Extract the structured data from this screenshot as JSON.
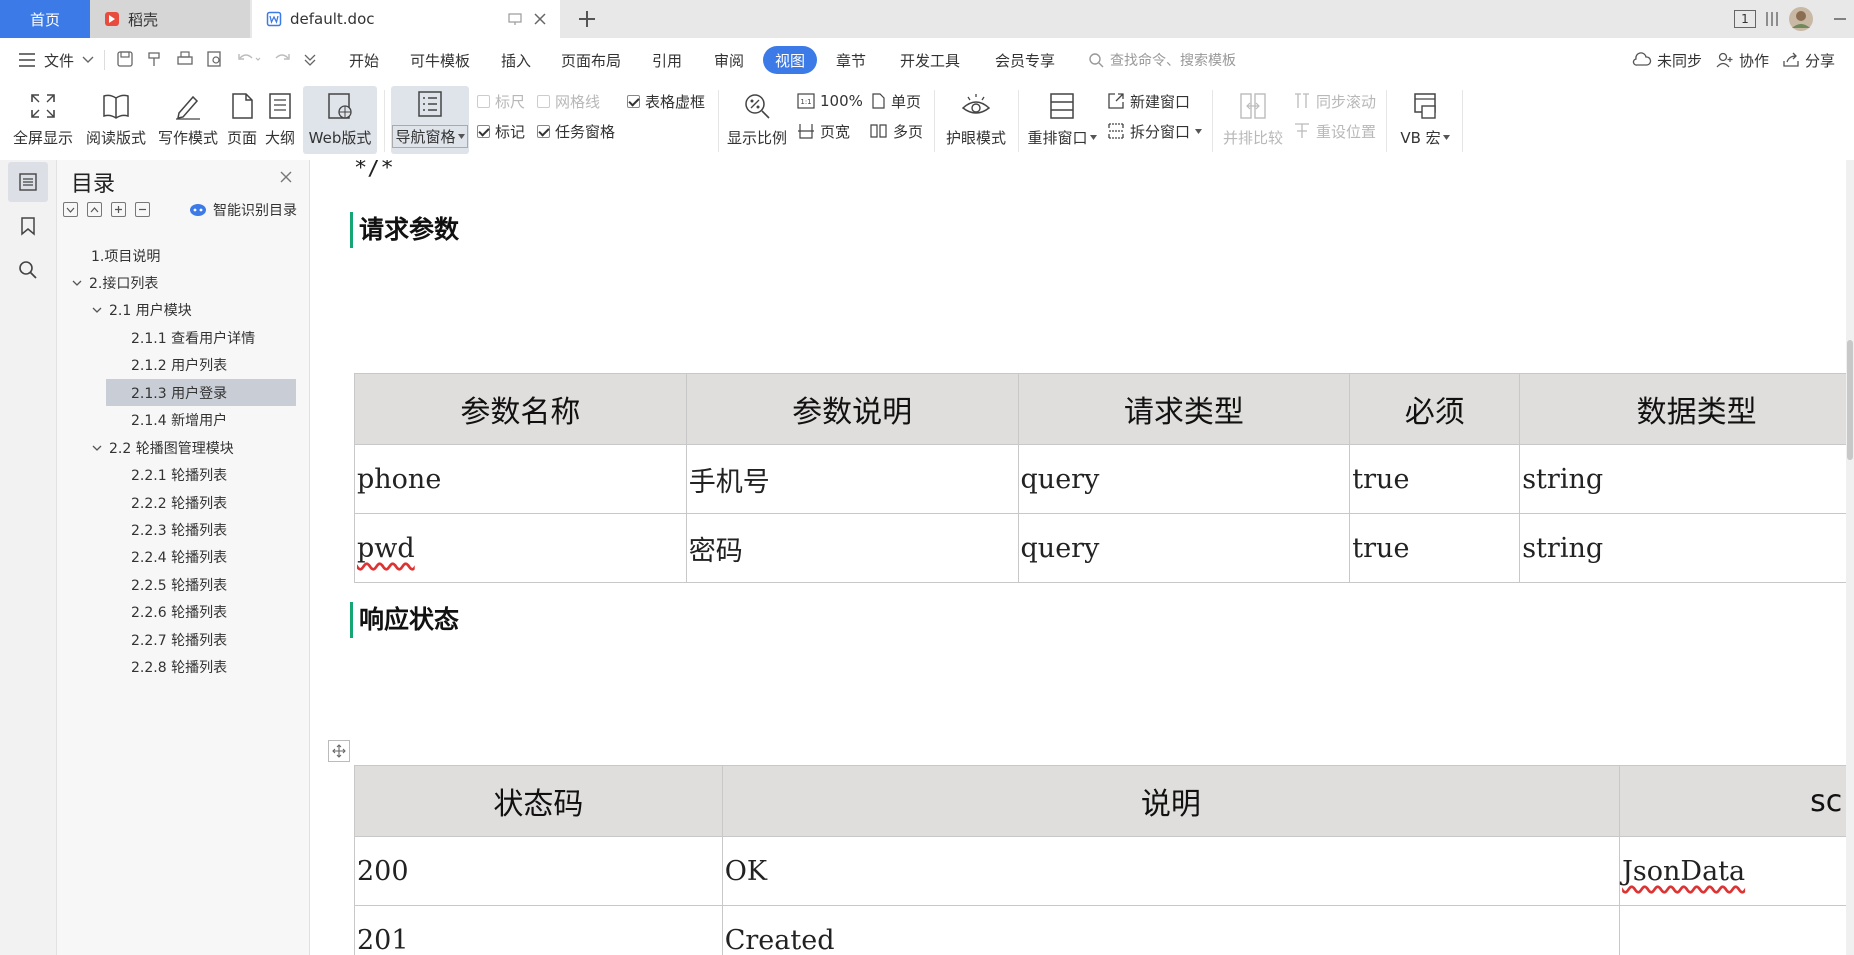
{
  "tabs": {
    "home": "首页",
    "daoke": "稻壳",
    "doc": "default.doc"
  },
  "titlebar": {
    "badge": "1"
  },
  "menu": {
    "file": "文件",
    "items": [
      "开始",
      "可牛模板",
      "插入",
      "页面布局",
      "引用",
      "审阅",
      "视图",
      "章节",
      "开发工具",
      "会员专享"
    ],
    "search_placeholder": "查找命令、搜索模板",
    "unsynced": "未同步",
    "collab": "协作",
    "share": "分享"
  },
  "ribbon": {
    "fullscreen": "全屏显示",
    "reading": "阅读版式",
    "writing": "写作模式",
    "page": "页面",
    "outline": "大纲",
    "web": "Web版式",
    "nav_pane": "导航窗格",
    "ruler": "标尺",
    "gridlines": "网格线",
    "table_gridlines": "表格虚框",
    "marks": "标记",
    "task_pane": "任务窗格",
    "zoom": "显示比例",
    "zoom100": "100%",
    "page_width": "页宽",
    "single_page": "单页",
    "multi_page": "多页",
    "eye_care": "护眼模式",
    "rearrange": "重排窗口",
    "new_window": "新建窗口",
    "split_window": "拆分窗口",
    "side_by_side": "并排比较",
    "sync_scroll": "同步滚动",
    "reset_pos": "重设位置",
    "vb_macro": "VB 宏"
  },
  "toc": {
    "title": "目录",
    "smart_toc": "智能识别目录",
    "items": [
      "1.项目说明",
      "2.接口列表",
      "2.1 用户模块",
      "2.1.1 查看用户详情",
      "2.1.2 用户列表",
      "2.1.3 用户登录",
      "2.1.4 新增用户",
      "2.2 轮播图管理模块",
      "2.2.1 轮播列表",
      "2.2.2 轮播列表",
      "2.2.3 轮播列表",
      "2.2.4 轮播列表",
      "2.2.5 轮播列表",
      "2.2.6 轮播列表",
      "2.2.7 轮播列表",
      "2.2.8 轮播列表"
    ]
  },
  "doc": {
    "code_fragment": "*/*",
    "heading_params": "请求参数",
    "params_table": {
      "headers": [
        "参数名称",
        "参数说明",
        "请求类型",
        "必须",
        "数据类型"
      ],
      "rows": [
        [
          "phone",
          "手机号",
          "query",
          "true",
          "string"
        ],
        [
          "pwd",
          "密码",
          "query",
          "true",
          "string"
        ]
      ]
    },
    "heading_status": "响应状态",
    "status_table": {
      "headers": [
        "状态码",
        "说明",
        "sc"
      ],
      "rows": [
        [
          "200",
          "OK",
          "JsonData"
        ],
        [
          "201",
          "Created",
          ""
        ]
      ]
    }
  }
}
